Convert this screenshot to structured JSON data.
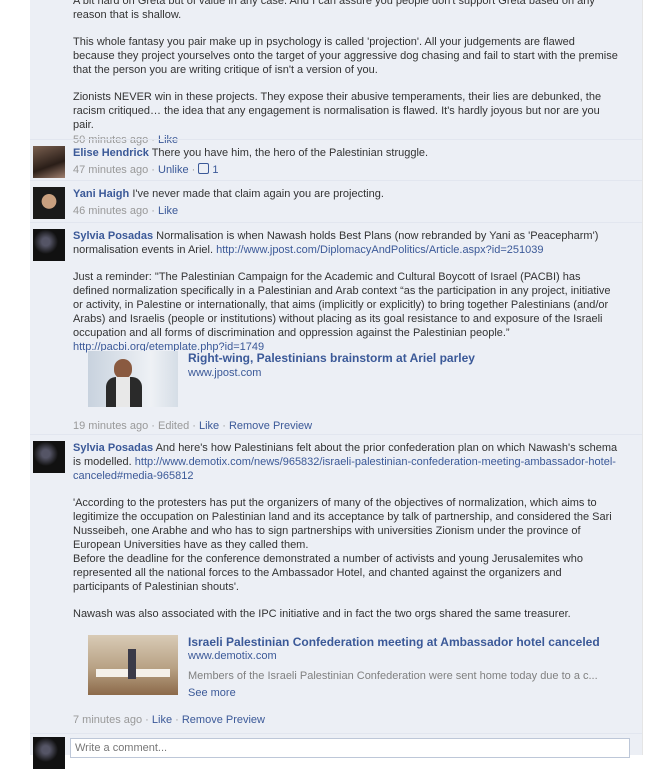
{
  "comments": [
    {
      "author": "",
      "paragraphs": [
        "A bit hard on Greta but of value in any case. And I can assure you people don't support Greta based on any reason that is shallow.",
        "This whole fantasy you pair make up in psychology is called 'projection'. All your judgements are flawed because they project yourselves onto the target of your aggressive dog chasing and fail to start with the premise that the person you are writing critique of isn't a version of you.",
        "Zionists NEVER win in these projects. They expose their abusive temperaments, their lies are debunked, the racism critiqued… the idea that any engagement is normalisation is flawed. It's hardly joyous but nor are you pair."
      ],
      "time": "50 minutes ago",
      "like": "Like"
    },
    {
      "author": "Elise Hendrick",
      "text": "There you have him, the hero of the Palestinian struggle.",
      "time": "47 minutes ago",
      "action": "Unlike",
      "like_count": "1"
    },
    {
      "author": "Yani Haigh",
      "text": "I've never made that claim again you are projecting.",
      "time": "46 minutes ago",
      "like": "Like"
    },
    {
      "author": "Sylvia Posadas",
      "text": "Normalisation is when Nawash holds Best Plans (now rebranded by Yani as 'Peacepharm') normalisation events in Ariel.",
      "url": "http://www.jpost.com/DiplomacyAndPolitics/Article.aspx?id=251039",
      "quote": "Just a reminder: \"The Palestinian Campaign for the Academic and Cultural Boycott of Israel (PACBI) has defined normalization specifically in a Palestinian and Arab context “as the participation in any project, initiative or activity, in Palestine or internationally, that aims (implicitly or explicitly) to bring together Palestinians (and/or Arabs) and Israelis (people or institutions) without placing as its goal resistance to and exposure of the Israeli occupation and all forms of discrimination and oppression against the Palestinian people.”",
      "quote_url": "http://pacbi.org/etemplate.php?id=1749",
      "preview_title": "Right-wing, Palestinians brainstorm at Ariel parley",
      "preview_domain": "www.jpost.com",
      "time": "19 minutes ago",
      "edited": "Edited",
      "like": "Like",
      "remove": "Remove Preview"
    },
    {
      "author": "Sylvia Posadas",
      "text": "And here's how Palestinians felt about the prior confederation plan on which Nawash's schema is modelled.",
      "url": "http://www.demotix.com/news/965832/israeli-palestinian-confederation-meeting-ambassador-hotel-canceled#media-965812",
      "paragraphs": [
        "'According to the protesters has put the organizers of many of the objectives of normalization, which aims to legitimize the occupation on Palestinian land and its acceptance by talk of partnership, and considered the Sari Nusseibeh, one Arabhe and who has to sign partnerships with universities Zionism under the province of European Universities have as they called them.",
        "Before the deadline for the conference demonstrated a number of activists and young Jerusalemites who represented all the national forces to the Ambassador Hotel, and chanted against the organizers and participants of Palestinian shouts'.",
        "Nawash was also associated with the IPC initiative and in fact the two orgs shared the same treasurer."
      ],
      "preview_title": "Israeli Palestinian Confederation meeting at Ambassador hotel canceled",
      "preview_domain": "www.demotix.com",
      "preview_summary": "Members of the Israeli Palestinian Confederation were sent home today due to a c...",
      "see_more": "See more",
      "time": "7 minutes ago",
      "like": "Like",
      "remove": "Remove Preview"
    }
  ],
  "composer": {
    "placeholder": "Write a comment..."
  }
}
